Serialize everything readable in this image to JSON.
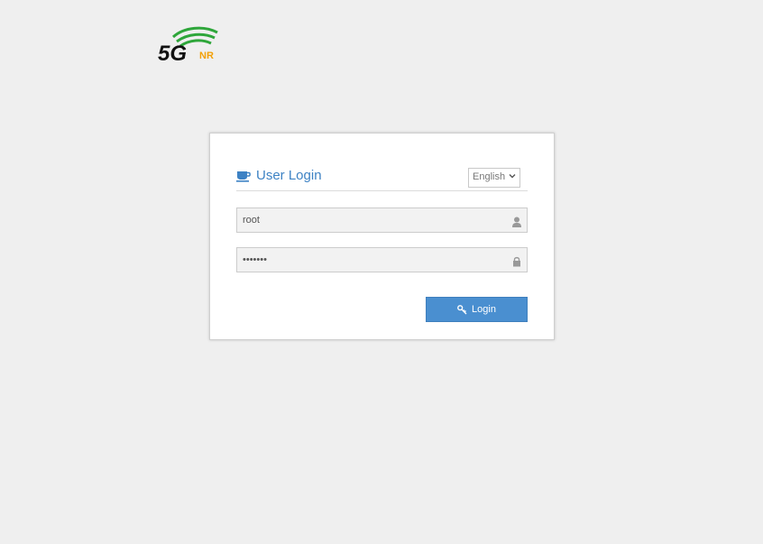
{
  "logo": {
    "main_text": "5G",
    "sub_text": "NR"
  },
  "login": {
    "title": "User Login",
    "language": "English",
    "username_value": "root",
    "password_value": "•••••••",
    "button_label": "Login"
  },
  "icons": {
    "title": "coffee-cup-icon",
    "username": "user-icon",
    "password": "lock-icon",
    "button": "key-icon",
    "language": "chevron-down-icon"
  },
  "colors": {
    "background": "#efefef",
    "accent": "#3d82c4",
    "button": "#4a8fd0",
    "logo_green": "#2ea63a",
    "logo_orange": "#f2a007"
  }
}
